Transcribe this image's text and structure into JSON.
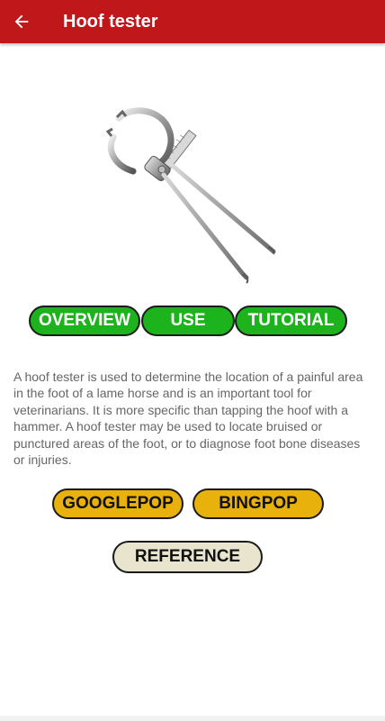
{
  "appbar": {
    "title": "Hoof tester",
    "back_icon": "arrow-left-icon",
    "background_color": "#c0181a"
  },
  "hero": {
    "image": "hoof-tester-tool-image"
  },
  "tabs": [
    {
      "label": "OVERVIEW"
    },
    {
      "label": "USE"
    },
    {
      "label": "TUTORIAL"
    }
  ],
  "description": "A hoof tester is used to determine the location of a painful area in the foot of a lame horse and is an important tool for veterinarians. It is more specific than tapping the hoof with a hammer. A hoof tester may be used to locate bruised or punctured areas of the foot, or to diagnose foot bone diseases or injuries.",
  "links": {
    "googlepop": "GOOGLEPOP",
    "bingpop": "BINGPOP",
    "reference": "REFERENCE"
  },
  "colors": {
    "tab_green": "#1db31d",
    "link_gold": "#e8b10c",
    "reference_beige": "#e9e4cd"
  }
}
